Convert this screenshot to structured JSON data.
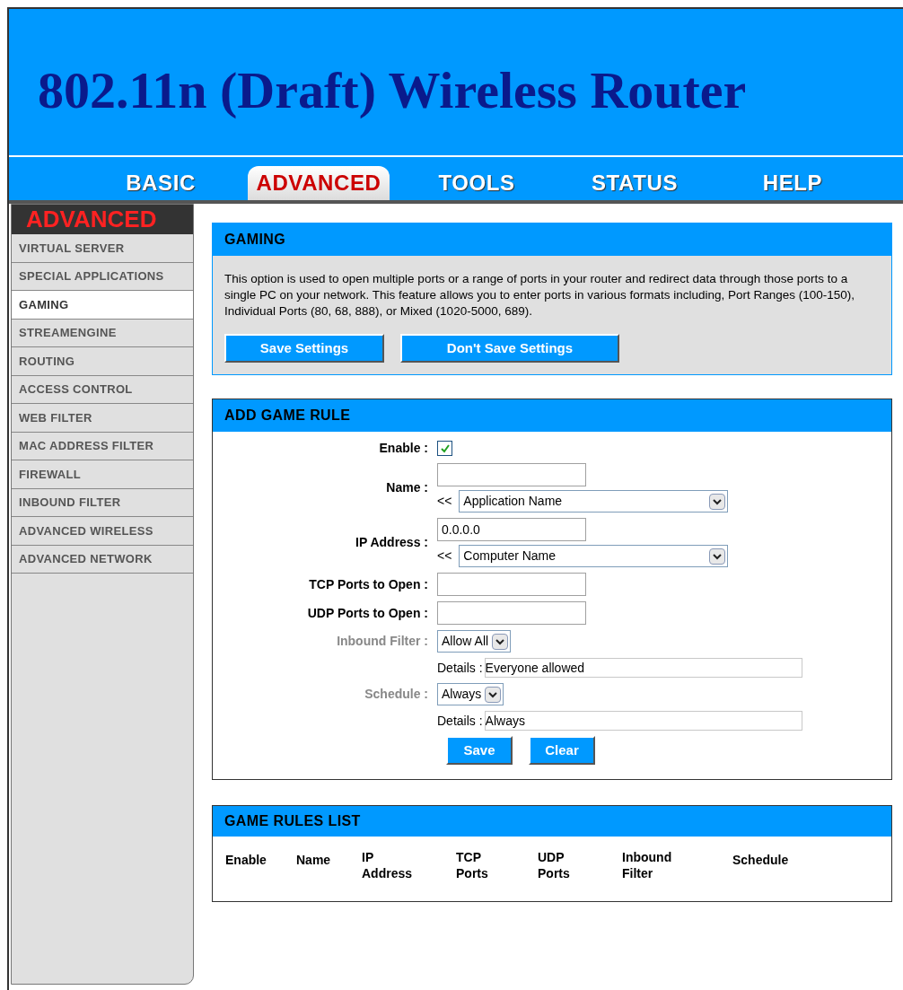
{
  "header": {
    "title": "802.11n (Draft) Wireless Router"
  },
  "tabs": [
    {
      "label": "BASIC",
      "selected": false
    },
    {
      "label": "ADVANCED",
      "selected": true
    },
    {
      "label": "TOOLS",
      "selected": false
    },
    {
      "label": "STATUS",
      "selected": false
    },
    {
      "label": "HELP",
      "selected": false
    }
  ],
  "sidebar": {
    "heading": "ADVANCED",
    "items": [
      {
        "label": "VIRTUAL SERVER",
        "selected": false
      },
      {
        "label": "SPECIAL APPLICATIONS",
        "selected": false
      },
      {
        "label": "GAMING",
        "selected": true
      },
      {
        "label": "STREAMENGINE",
        "selected": false
      },
      {
        "label": "ROUTING",
        "selected": false
      },
      {
        "label": "ACCESS CONTROL",
        "selected": false
      },
      {
        "label": "WEB FILTER",
        "selected": false
      },
      {
        "label": "MAC ADDRESS FILTER",
        "selected": false
      },
      {
        "label": "FIREWALL",
        "selected": false
      },
      {
        "label": "INBOUND FILTER",
        "selected": false
      },
      {
        "label": "ADVANCED WIRELESS",
        "selected": false
      },
      {
        "label": "ADVANCED NETWORK",
        "selected": false
      }
    ]
  },
  "gaming": {
    "title": "GAMING",
    "description": "This option is used to open multiple ports or a range of ports in your router and redirect data through those ports to a single PC on your network. This feature allows you to enter ports in various formats including, Port Ranges (100-150), Individual Ports (80, 68, 888), or Mixed (1020-5000, 689).",
    "buttons": [
      "Save Settings",
      "Don't Save Settings"
    ]
  },
  "add_game_rule": {
    "title": "ADD GAME RULE",
    "rows": [
      {
        "label": "Enable :",
        "disabled": false,
        "controls": [
          {
            "kind": "checkbox",
            "checked": true
          }
        ]
      },
      {
        "label": "Name :",
        "disabled": false,
        "controls": [
          {
            "kind": "text"
          },
          {
            "kind": "picker",
            "prefix": "<<",
            "value": "Application Name"
          }
        ]
      },
      {
        "label": "IP Address :",
        "disabled": false,
        "controls": [
          {
            "kind": "text",
            "value": "0.0.0.0"
          },
          {
            "kind": "picker",
            "prefix": "<<",
            "value": "Computer Name"
          }
        ]
      },
      {
        "label": "TCP Ports to Open :",
        "disabled": false,
        "controls": [
          {
            "kind": "text"
          }
        ]
      },
      {
        "label": "UDP Ports to Open :",
        "disabled": false,
        "controls": [
          {
            "kind": "text"
          }
        ]
      },
      {
        "label": "Inbound Filter :",
        "disabled": true,
        "controls": [
          {
            "kind": "dropdown",
            "value": "Allow All"
          }
        ]
      },
      {
        "controls": [
          {
            "kind": "details",
            "label": "Details :",
            "value": "Everyone allowed"
          }
        ]
      },
      {
        "label": "Schedule :",
        "disabled": true,
        "controls": [
          {
            "kind": "dropdown",
            "value": "Always"
          }
        ]
      },
      {
        "controls": [
          {
            "kind": "details",
            "label": "Details :",
            "value": "Always"
          }
        ]
      }
    ],
    "buttons": [
      "Save",
      "Clear"
    ]
  },
  "game_rules_list": {
    "title": "GAME RULES LIST",
    "columns": [
      "Enable",
      "Name",
      "IP Address",
      "TCP Ports",
      "UDP Ports",
      "Inbound Filter",
      "Schedule"
    ]
  }
}
